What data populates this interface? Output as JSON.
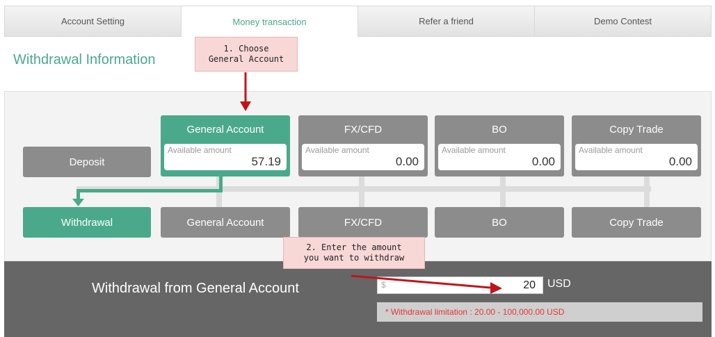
{
  "tabs": [
    {
      "label": "Account Setting",
      "active": false
    },
    {
      "label": "Money transaction",
      "active": true
    },
    {
      "label": "Refer a friend",
      "active": false
    },
    {
      "label": "Demo Contest",
      "active": false
    }
  ],
  "section_title": "Withdrawal Information",
  "callouts": {
    "step1_line1": "1. Choose",
    "step1_line2": "General Account",
    "step2_line1": "2. Enter the amount",
    "step2_line2": "you want to withdraw"
  },
  "accounts": [
    {
      "name": "General Account",
      "available_label": "Available amount",
      "amount": "57.19",
      "selected": true
    },
    {
      "name": "FX/CFD",
      "available_label": "Available amount",
      "amount": "0.00",
      "selected": false
    },
    {
      "name": "BO",
      "available_label": "Available amount",
      "amount": "0.00",
      "selected": false
    },
    {
      "name": "Copy Trade",
      "available_label": "Available amount",
      "amount": "0.00",
      "selected": false
    }
  ],
  "deposit_label": "Deposit",
  "targets": [
    {
      "label": "Withdrawal",
      "selected": true
    },
    {
      "label": "General Account",
      "selected": false
    },
    {
      "label": "FX/CFD",
      "selected": false
    },
    {
      "label": "BO",
      "selected": false
    },
    {
      "label": "Copy Trade",
      "selected": false
    }
  ],
  "withdraw": {
    "title": "Withdrawal from General Account",
    "currency_prefix": "$",
    "amount": "20",
    "currency": "USD",
    "limitation": "* Withdrawal limitation : 20.00 - 100,000.00 USD"
  },
  "colors": {
    "accent": "#4aa98a",
    "inactive": "#8c8c8c",
    "callout": "#f8d7d7",
    "arrow": "#c0141b",
    "limit_text": "#e53535"
  }
}
